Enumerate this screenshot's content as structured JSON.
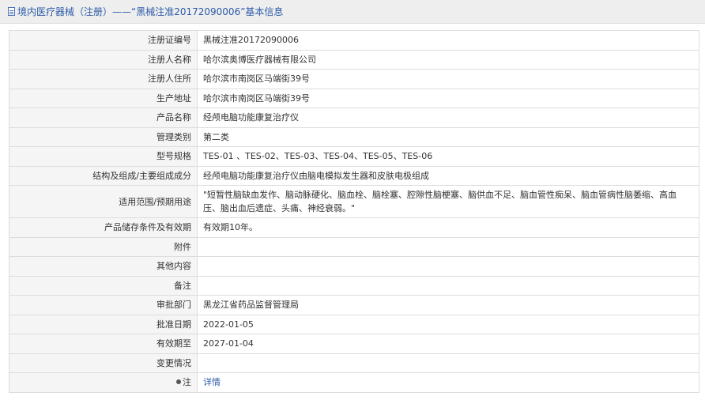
{
  "header": {
    "title": "境内医疗器械（注册）——“黑械注准20172090006”基本信息"
  },
  "rows": [
    {
      "label": "注册证编号",
      "value": "黑械注准20172090006"
    },
    {
      "label": "注册人名称",
      "value": "哈尔滨奥博医疗器械有限公司"
    },
    {
      "label": "注册人住所",
      "value": "哈尔滨市南岗区马端街39号"
    },
    {
      "label": "生产地址",
      "value": "哈尔滨市南岗区马端街39号"
    },
    {
      "label": "产品名称",
      "value": "经颅电脑功能康复治疗仪"
    },
    {
      "label": "管理类别",
      "value": "第二类"
    },
    {
      "label": "型号规格",
      "value": "TES-01 、TES-02、TES-03、TES-04、TES-05、TES-06"
    },
    {
      "label": "结构及组成/主要组成成分",
      "value": "经颅电脑功能康复治疗仪由脑电模拟发生器和皮肤电极组成"
    },
    {
      "label": "适用范围/预期用途",
      "value": "\"短暂性脑缺血发作、脑动脉硬化、脑血栓、脑栓塞、腔隙性脑梗塞、脑供血不足、脑血管性痴呆、脑血管病性脑萎缩、高血压、脑出血后遗症、头痛、神经衰弱。\""
    },
    {
      "label": "产品储存条件及有效期",
      "value": "有效期10年。"
    },
    {
      "label": "附件",
      "value": ""
    },
    {
      "label": "其他内容",
      "value": ""
    },
    {
      "label": "备注",
      "value": ""
    },
    {
      "label": "审批部门",
      "value": "黑龙江省药品监督管理局"
    },
    {
      "label": "批准日期",
      "value": "2022-01-05"
    },
    {
      "label": "有效期至",
      "value": "2027-01-04"
    },
    {
      "label": "变更情况",
      "value": ""
    }
  ],
  "note_row": {
    "label": "注",
    "link": "详情"
  }
}
